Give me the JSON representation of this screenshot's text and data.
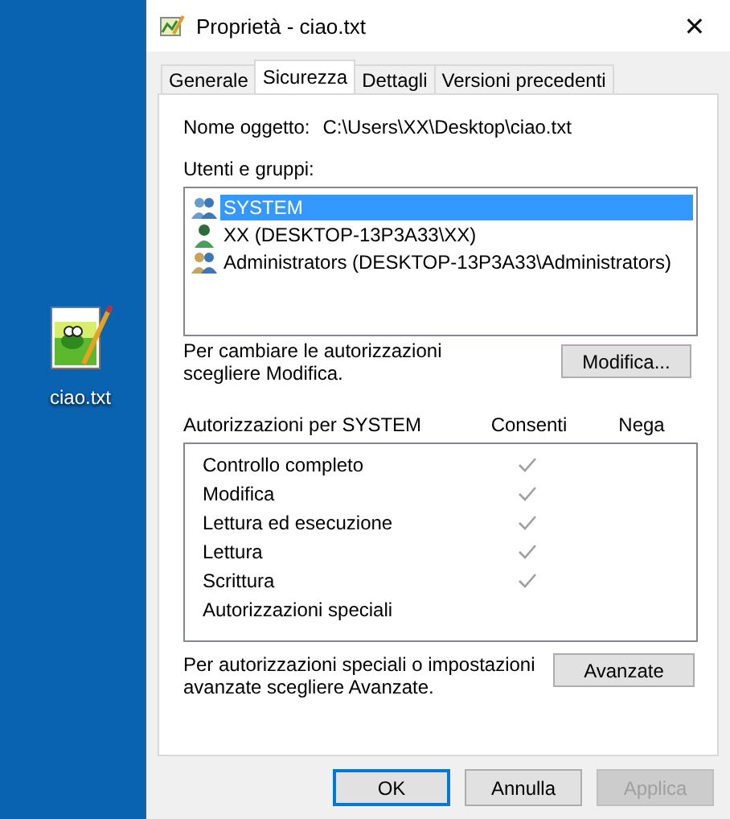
{
  "desktop": {
    "icon_label": "ciao.txt"
  },
  "window": {
    "title": "Proprietà - ciao.txt",
    "close": "✕"
  },
  "tabs": [
    {
      "label": "Generale",
      "selected": false
    },
    {
      "label": "Sicurezza",
      "selected": true
    },
    {
      "label": "Dettagli",
      "selected": false
    },
    {
      "label": "Versioni precedenti",
      "selected": false
    }
  ],
  "object_name": {
    "label": "Nome oggetto:",
    "value": "C:\\Users\\XX\\Desktop\\ciao.txt"
  },
  "users_label": "Utenti e gruppi:",
  "users": [
    {
      "name": "SYSTEM",
      "kind": "system",
      "selected": true
    },
    {
      "name": "XX (DESKTOP-13P3A33\\XX)",
      "kind": "user",
      "selected": false
    },
    {
      "name": "Administrators (DESKTOP-13P3A33\\Administrators)",
      "kind": "group",
      "selected": false
    }
  ],
  "change_hint": "Per cambiare le autorizzazioni scegliere Modifica.",
  "edit_button": "Modifica...",
  "permissions": {
    "title": "Autorizzazioni per SYSTEM",
    "allow_label": "Consenti",
    "deny_label": "Nega",
    "rows": [
      {
        "name": "Controllo completo",
        "allow": true
      },
      {
        "name": "Modifica",
        "allow": true
      },
      {
        "name": "Lettura ed esecuzione",
        "allow": true
      },
      {
        "name": "Lettura",
        "allow": true
      },
      {
        "name": "Scrittura",
        "allow": true
      },
      {
        "name": "Autorizzazioni speciali",
        "allow": false
      }
    ]
  },
  "advanced_hint": "Per autorizzazioni speciali o impostazioni avanzate scegliere Avanzate.",
  "advanced_button": "Avanzate",
  "buttons": [
    {
      "label": "OK",
      "default": true,
      "disabled": false
    },
    {
      "label": "Annulla",
      "default": false,
      "disabled": false
    },
    {
      "label": "Applica",
      "default": false,
      "disabled": true
    }
  ]
}
